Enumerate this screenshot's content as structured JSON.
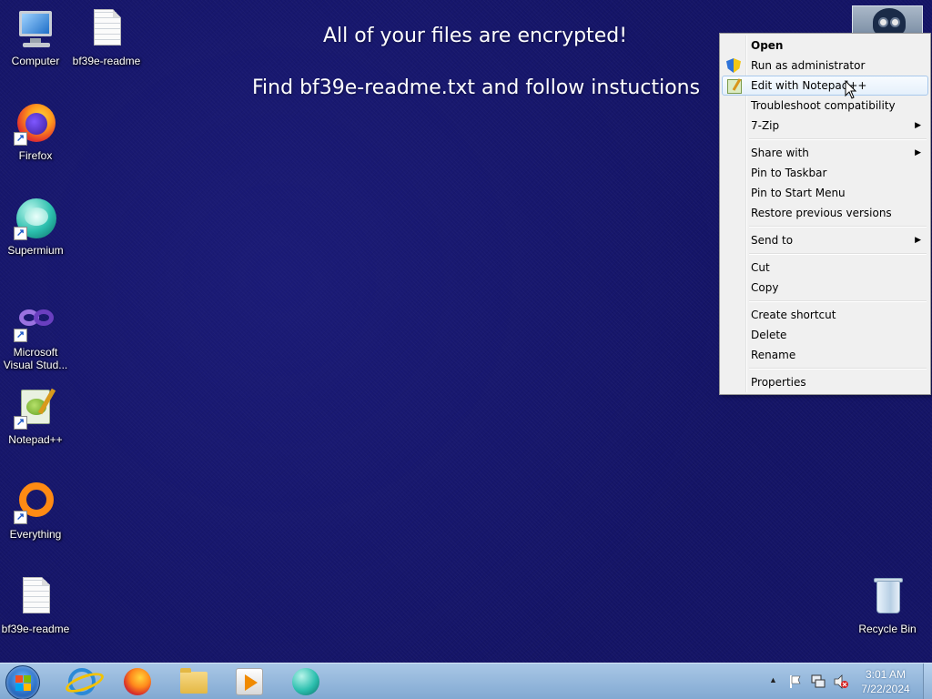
{
  "wallpaper": {
    "line1": "All of your files are encrypted!",
    "line2": "Find bf39e-readme.txt and follow instuctions"
  },
  "desktop_icons": [
    {
      "label": "Computer",
      "icon": "computer-icon",
      "shortcut": false
    },
    {
      "label": "bf39e-readme",
      "icon": "text-document-icon",
      "shortcut": false
    },
    {
      "label": "Firefox",
      "icon": "firefox-icon",
      "shortcut": true
    },
    {
      "label": "Supermium",
      "icon": "supermium-icon",
      "shortcut": true
    },
    {
      "label": "Microsoft Visual Stud...",
      "icon": "visual-studio-icon",
      "shortcut": true
    },
    {
      "label": "Notepad++",
      "icon": "notepad-plus-plus-icon",
      "shortcut": true
    },
    {
      "label": "Everything",
      "icon": "everything-search-icon",
      "shortcut": true
    },
    {
      "label": "bf39e-readme",
      "icon": "text-document-icon",
      "shortcut": false
    },
    {
      "label": "Recycle Bin",
      "icon": "recycle-bin-icon",
      "shortcut": false
    }
  ],
  "context_menu": {
    "items": [
      {
        "label": "Open",
        "bold": true
      },
      {
        "label": "Run as administrator",
        "icon": "uac-shield-icon"
      },
      {
        "label": "Edit with Notepad++",
        "icon": "notepad-plus-plus-icon",
        "highlighted": true
      },
      {
        "label": "Troubleshoot compatibility"
      },
      {
        "label": "7-Zip",
        "submenu": true
      },
      {
        "separator": true
      },
      {
        "label": "Share with",
        "submenu": true
      },
      {
        "label": "Pin to Taskbar"
      },
      {
        "label": "Pin to Start Menu"
      },
      {
        "label": "Restore previous versions"
      },
      {
        "separator": true
      },
      {
        "label": "Send to",
        "submenu": true
      },
      {
        "separator": true
      },
      {
        "label": "Cut"
      },
      {
        "label": "Copy"
      },
      {
        "separator": true
      },
      {
        "label": "Create shortcut"
      },
      {
        "label": "Delete"
      },
      {
        "label": "Rename"
      },
      {
        "separator": true
      },
      {
        "label": "Properties"
      }
    ]
  },
  "taskbar": {
    "pinned": [
      "internet-explorer-icon",
      "firefox-icon",
      "windows-explorer-icon",
      "windows-media-player-icon",
      "supermium-icon"
    ],
    "tray": {
      "time": "3:01 AM",
      "date": "7/22/2024",
      "icons": [
        "show-hidden-icons-arrow",
        "action-center-flag-icon",
        "network-icon",
        "volume-muted-icon"
      ]
    }
  },
  "colors": {
    "desktop_background": "#141466",
    "menu_background": "#f0f0f0",
    "menu_highlight_border": "#a8c8ec",
    "taskbar": "#92b5da"
  }
}
